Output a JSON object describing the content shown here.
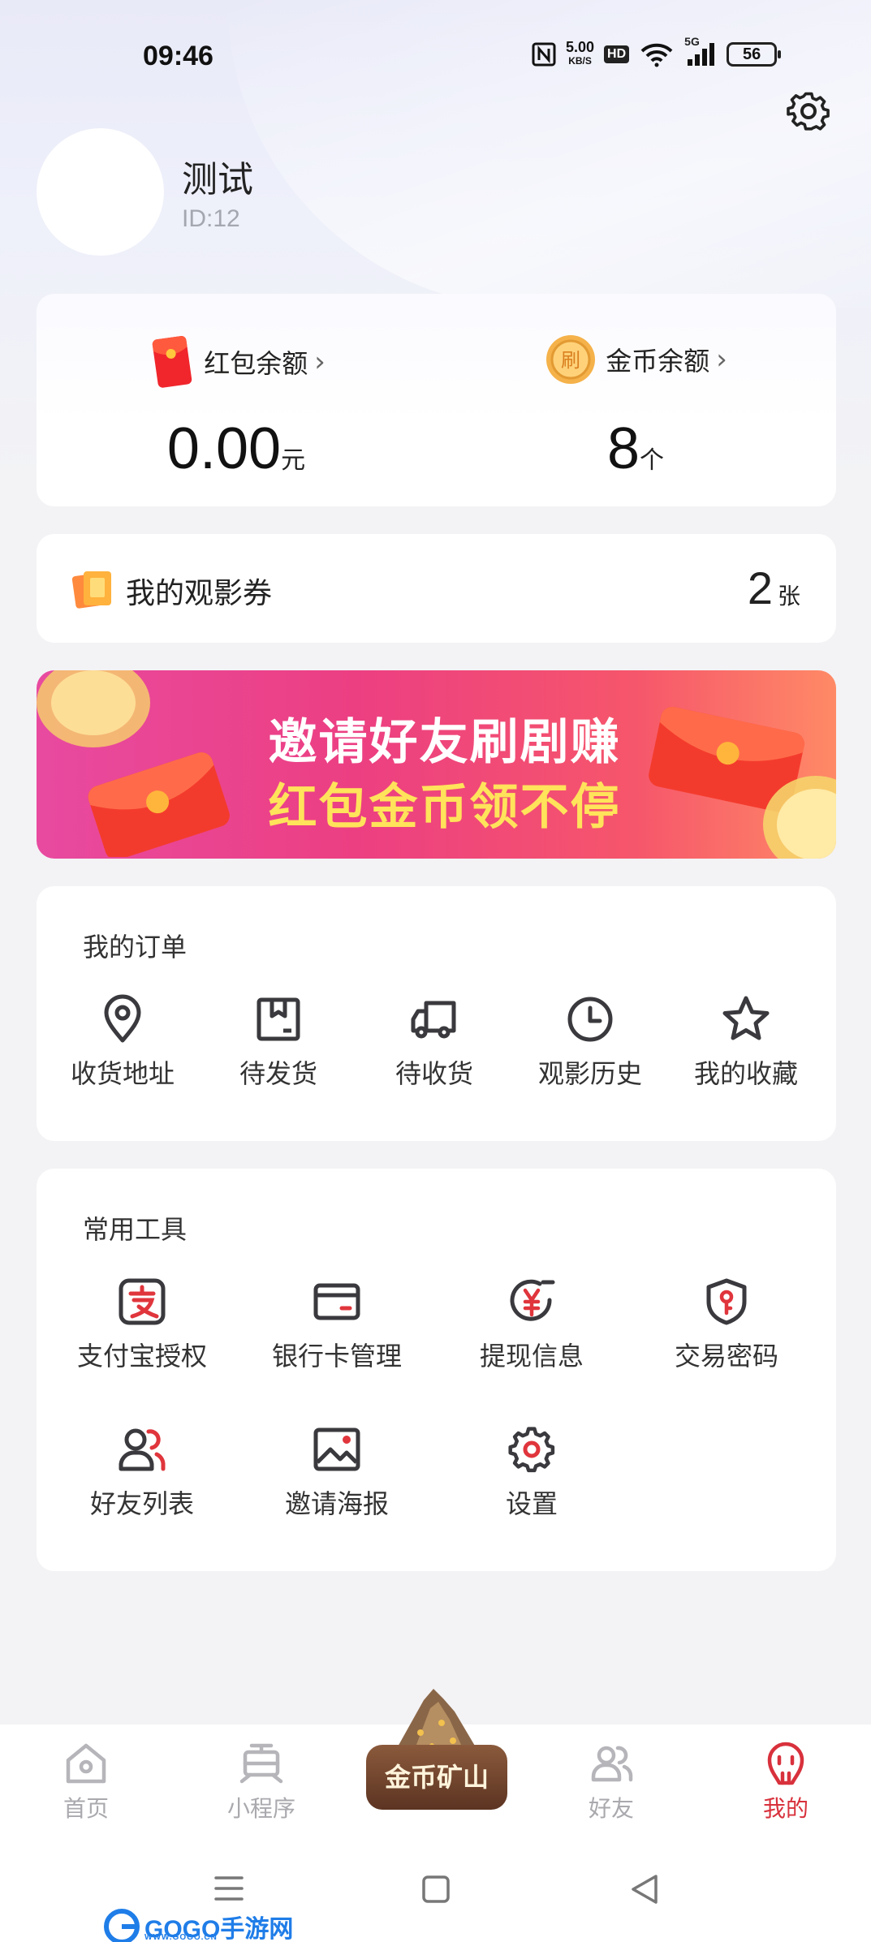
{
  "status_bar": {
    "time": "09:46",
    "net_speed_top": "5.00",
    "net_speed_unit": "KB/S",
    "hd": "HD",
    "signal": "5G",
    "battery": "56"
  },
  "profile": {
    "name": "测试",
    "id": "ID:12"
  },
  "wallet": {
    "red_packet": {
      "label": "红包余额",
      "value": "0.00",
      "unit": "元"
    },
    "coins": {
      "label": "金币余额",
      "value": "8",
      "unit": "个"
    }
  },
  "tickets": {
    "label": "我的观影券",
    "count": "2",
    "unit": "张"
  },
  "banner": {
    "line1": "邀请好友刷剧赚",
    "line2": "红包金币领不停"
  },
  "orders": {
    "title": "我的订单",
    "items": [
      {
        "label": "收货地址",
        "icon": "location-pin-icon"
      },
      {
        "label": "待发货",
        "icon": "box-icon"
      },
      {
        "label": "待收货",
        "icon": "truck-icon"
      },
      {
        "label": "观影历史",
        "icon": "clock-icon"
      },
      {
        "label": "我的收藏",
        "icon": "star-icon"
      }
    ]
  },
  "tools": {
    "title": "常用工具",
    "items": [
      {
        "label": "支付宝授权",
        "icon": "alipay-icon"
      },
      {
        "label": "银行卡管理",
        "icon": "bank-card-icon"
      },
      {
        "label": "提现信息",
        "icon": "yuan-refresh-icon"
      },
      {
        "label": "交易密码",
        "icon": "shield-key-icon"
      },
      {
        "label": "好友列表",
        "icon": "friends-icon"
      },
      {
        "label": "邀请海报",
        "icon": "image-icon"
      },
      {
        "label": "设置",
        "icon": "gear-icon"
      }
    ]
  },
  "tabbar": {
    "items": [
      {
        "label": "首页",
        "icon": "home-icon"
      },
      {
        "label": "小程序",
        "icon": "mini-program-icon"
      },
      {
        "label": "金币矿山",
        "icon": "mine-icon"
      },
      {
        "label": "好友",
        "icon": "friends-tab-icon"
      },
      {
        "label": "我的",
        "icon": "mine-profile-icon"
      }
    ],
    "active": "我的"
  },
  "watermark": {
    "text": "GOGO手游网",
    "sub": "WWW.GOGO.CN"
  },
  "colors": {
    "accent": "#d8313c",
    "banner_yellow": "#ffe35a",
    "icon_stroke": "#3a3a3e"
  }
}
